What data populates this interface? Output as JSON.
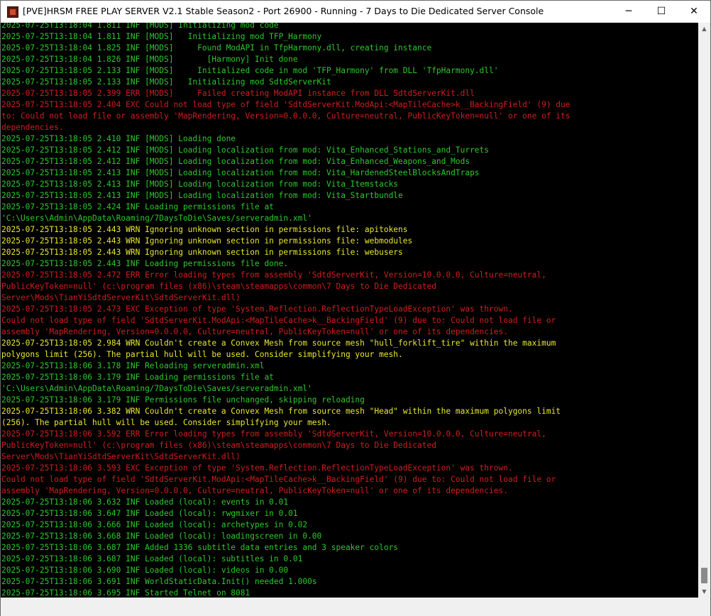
{
  "window": {
    "title": "[PVE]HRSM FREE PLAY SERVER V2.1 Stable Season2 - Port 26900 - Running - 7 Days to Die Dedicated Server Console",
    "icon": "game-app-icon",
    "controls": {
      "minimize": "─",
      "maximize": "☐",
      "close": "✕"
    }
  },
  "colors": {
    "inf": "#2dc82d",
    "err": "#d21e1e",
    "wrn": "#e8e830",
    "background": "#000000"
  },
  "scrollbar": {
    "up": "▲",
    "down": "▼"
  },
  "log": [
    {
      "level": "inf",
      "text": "2025-07-25T13:18:04 1.811 INF [MODS] Initializing mod code"
    },
    {
      "level": "inf",
      "text": "2025-07-25T13:18:04 1.811 INF [MODS]   Initializing mod TFP_Harmony"
    },
    {
      "level": "inf",
      "text": "2025-07-25T13:18:04 1.825 INF [MODS]     Found ModAPI in TfpHarmony.dll, creating instance"
    },
    {
      "level": "inf",
      "text": "2025-07-25T13:18:04 1.826 INF [MODS]       [Harmony] Init done"
    },
    {
      "level": "inf",
      "text": "2025-07-25T13:18:05 2.133 INF [MODS]     Initialized code in mod 'TFP_Harmony' from DLL 'TfpHarmony.dll'"
    },
    {
      "level": "inf",
      "text": "2025-07-25T13:18:05 2.133 INF [MODS]   Initializing mod SdtdServerKit"
    },
    {
      "level": "err",
      "text": "2025-07-25T13:18:05 2.399 ERR [MODS]     Failed creating ModAPI instance from DLL SdtdServerKit.dll"
    },
    {
      "level": "exc",
      "text": "2025-07-25T13:18:05 2.404 EXC Could not load type of field 'SdtdServerKit.ModApi:<MapTileCache>k__BackingField' (9) due"
    },
    {
      "level": "exc",
      "text": "to: Could not load file or assembly 'MapRendering, Version=0.0.0.0, Culture=neutral, PublicKeyToken=null' or one of its"
    },
    {
      "level": "exc",
      "text": "dependencies."
    },
    {
      "level": "inf",
      "text": "2025-07-25T13:18:05 2.410 INF [MODS] Loading done"
    },
    {
      "level": "inf",
      "text": "2025-07-25T13:18:05 2.412 INF [MODS] Loading localization from mod: Vita_Enhanced_Stations_and_Turrets"
    },
    {
      "level": "inf",
      "text": "2025-07-25T13:18:05 2.412 INF [MODS] Loading localization from mod: Vita_Enhanced_Weapons_and_Mods"
    },
    {
      "level": "inf",
      "text": "2025-07-25T13:18:05 2.413 INF [MODS] Loading localization from mod: Vita_HardenedSteelBlocksAndTraps"
    },
    {
      "level": "inf",
      "text": "2025-07-25T13:18:05 2.413 INF [MODS] Loading localization from mod: Vita_Itemstacks"
    },
    {
      "level": "inf",
      "text": "2025-07-25T13:18:05 2.413 INF [MODS] Loading localization from mod: Vita_Startbundle"
    },
    {
      "level": "inf",
      "text": "2025-07-25T13:18:05 2.424 INF Loading permissions file at"
    },
    {
      "level": "inf",
      "text": "'C:\\Users\\Admin\\AppData\\Roaming/7DaysToDie\\Saves/serveradmin.xml'"
    },
    {
      "level": "wrn",
      "text": "2025-07-25T13:18:05 2.443 WRN Ignoring unknown section in permissions file: apitokens"
    },
    {
      "level": "wrn",
      "text": "2025-07-25T13:18:05 2.443 WRN Ignoring unknown section in permissions file: webmodules"
    },
    {
      "level": "wrn",
      "text": "2025-07-25T13:18:05 2.443 WRN Ignoring unknown section in permissions file: webusers"
    },
    {
      "level": "inf",
      "text": "2025-07-25T13:18:05 2.443 INF Loading permissions file done."
    },
    {
      "level": "err",
      "text": "2025-07-25T13:18:05 2.472 ERR Error loading types from assembly 'SdtdServerKit, Version=10.0.0.0, Culture=neutral,"
    },
    {
      "level": "err",
      "text": "PublicKeyToken=null' (c:\\program files (x86)\\steam\\steamapps\\common\\7 Days to Die Dedicated"
    },
    {
      "level": "err",
      "text": "Server\\Mods\\TianYiSdtdServerKit\\SdtdServerKit.dll)"
    },
    {
      "level": "exc",
      "text": "2025-07-25T13:18:05 2.473 EXC Exception of type 'System.Reflection.ReflectionTypeLoadException' was thrown."
    },
    {
      "level": "exc",
      "text": "Could not load type of field 'SdtdServerKit.ModApi:<MapTileCache>k__BackingField' (9) due to: Could not load file or"
    },
    {
      "level": "exc",
      "text": "assembly 'MapRendering, Version=0.0.0.0, Culture=neutral, PublicKeyToken=null' or one of its dependencies."
    },
    {
      "level": "wrn",
      "text": "2025-07-25T13:18:05 2.984 WRN Couldn't create a Convex Mesh from source mesh \"hull_forklift_tire\" within the maximum"
    },
    {
      "level": "wrn",
      "text": "polygons limit (256). The partial hull will be used. Consider simplifying your mesh."
    },
    {
      "level": "inf",
      "text": "2025-07-25T13:18:06 3.178 INF Reloading serveradmin.xml"
    },
    {
      "level": "inf",
      "text": "2025-07-25T13:18:06 3.179 INF Loading permissions file at"
    },
    {
      "level": "inf",
      "text": "'C:\\Users\\Admin\\AppData\\Roaming/7DaysToDie\\Saves/serveradmin.xml'"
    },
    {
      "level": "inf",
      "text": "2025-07-25T13:18:06 3.179 INF Permissions file unchanged, skipping reloading"
    },
    {
      "level": "wrn",
      "text": "2025-07-25T13:18:06 3.382 WRN Couldn't create a Convex Mesh from source mesh \"Head\" within the maximum polygons limit"
    },
    {
      "level": "wrn",
      "text": "(256). The partial hull will be used. Consider simplifying your mesh."
    },
    {
      "level": "err",
      "text": "2025-07-25T13:18:06 3.592 ERR Error loading types from assembly 'SdtdServerKit, Version=10.0.0.0, Culture=neutral,"
    },
    {
      "level": "err",
      "text": "PublicKeyToken=null' (c:\\program files (x86)\\steam\\steamapps\\common\\7 Days to Die Dedicated"
    },
    {
      "level": "err",
      "text": "Server\\Mods\\TianYiSdtdServerKit\\SdtdServerKit.dll)"
    },
    {
      "level": "exc",
      "text": "2025-07-25T13:18:06 3.593 EXC Exception of type 'System.Reflection.ReflectionTypeLoadException' was thrown."
    },
    {
      "level": "exc",
      "text": "Could not load type of field 'SdtdServerKit.ModApi:<MapTileCache>k__BackingField' (9) due to: Could not load file or"
    },
    {
      "level": "exc",
      "text": "assembly 'MapRendering, Version=0.0.0.0, Culture=neutral, PublicKeyToken=null' or one of its dependencies."
    },
    {
      "level": "inf",
      "text": "2025-07-25T13:18:06 3.632 INF Loaded (local): events in 0.01"
    },
    {
      "level": "inf",
      "text": "2025-07-25T13:18:06 3.647 INF Loaded (local): rwgmixer in 0.01"
    },
    {
      "level": "inf",
      "text": "2025-07-25T13:18:06 3.666 INF Loaded (local): archetypes in 0.02"
    },
    {
      "level": "inf",
      "text": "2025-07-25T13:18:06 3.668 INF Loaded (local): loadingscreen in 0.00"
    },
    {
      "level": "inf",
      "text": "2025-07-25T13:18:06 3.687 INF Added 1336 subtitle data entries and 3 speaker colors"
    },
    {
      "level": "inf",
      "text": "2025-07-25T13:18:06 3.687 INF Loaded (local): subtitles in 0.01"
    },
    {
      "level": "inf",
      "text": "2025-07-25T13:18:06 3.690 INF Loaded (local): videos in 0.00"
    },
    {
      "level": "inf",
      "text": "2025-07-25T13:18:06 3.691 INF WorldStaticData.Init() needed 1.000s"
    },
    {
      "level": "inf",
      "text": "2025-07-25T13:18:06 3.695 INF Started Telnet on 8081"
    }
  ]
}
